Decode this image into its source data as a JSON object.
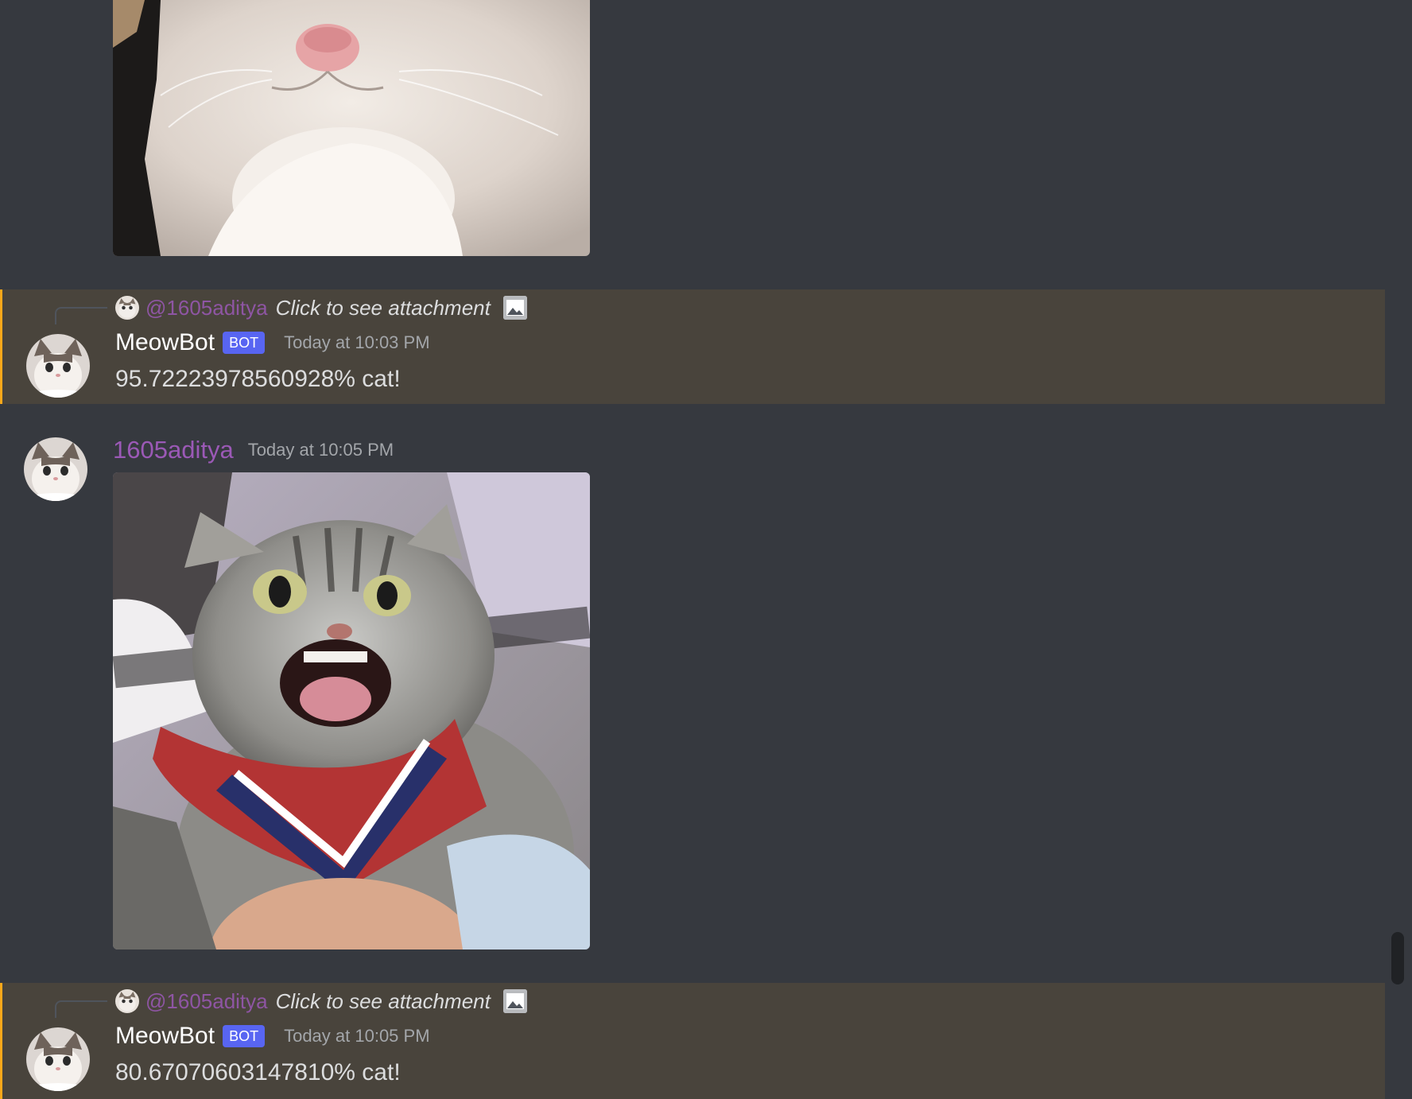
{
  "messages": [
    {
      "type": "bot_reply",
      "reply": {
        "mention": "@1605aditya",
        "text": "Click to see attachment"
      },
      "author": "MeowBot",
      "tag": "BOT",
      "timestamp": "Today at 10:03 PM",
      "content": "95.72223978560928% cat!"
    },
    {
      "type": "user",
      "author": "1605aditya",
      "timestamp": "Today at 10:05 PM"
    },
    {
      "type": "bot_reply",
      "reply": {
        "mention": "@1605aditya",
        "text": "Click to see attachment"
      },
      "author": "MeowBot",
      "tag": "BOT",
      "timestamp": "Today at 10:05 PM",
      "content": "80.67070603147810% cat!"
    }
  ],
  "colors": {
    "background": "#36393f",
    "mention_highlight": "#49443c",
    "mention_border": "#faa81a",
    "bot_tag": "#5865f2",
    "user_name": "#9b59b6",
    "text": "#dcddde",
    "timestamp": "#a3a6aa"
  },
  "icons": {
    "reply_image": "image-icon"
  }
}
